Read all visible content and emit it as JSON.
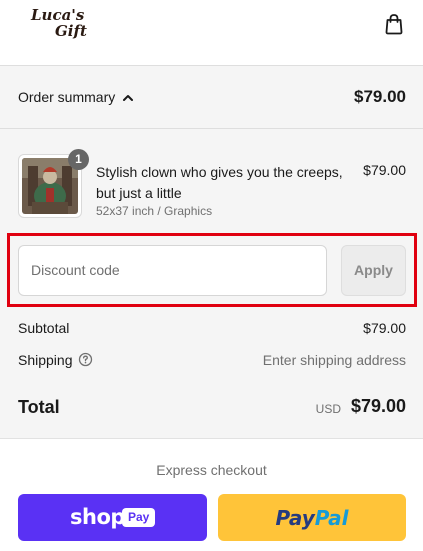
{
  "brand": {
    "logo_line1": "Luca's",
    "logo_line2": "Gift"
  },
  "header": {
    "cart_icon": "shopping-bag-icon"
  },
  "summary": {
    "toggle_label": "Order summary",
    "total": "$79.00",
    "chevron_icon": "chevron-up-icon"
  },
  "product": {
    "title": "Stylish clown who gives you the creeps, but just a little",
    "variant": "52x37 inch / Graphics",
    "price": "$79.00",
    "quantity": "1"
  },
  "discount": {
    "placeholder": "Discount code",
    "apply_label": "Apply"
  },
  "totals": {
    "subtotal_label": "Subtotal",
    "subtotal_value": "$79.00",
    "shipping_label": "Shipping",
    "shipping_value": "Enter shipping address",
    "total_label": "Total",
    "currency": "USD",
    "total_value": "$79.00"
  },
  "express": {
    "label": "Express checkout",
    "shop_pay": {
      "word": "shop",
      "pill": "Pay"
    },
    "paypal": {
      "part1": "Pay",
      "part2": "Pal"
    }
  },
  "colors": {
    "shop_pay": "#5a31f4",
    "paypal": "#ffc439",
    "highlight": "#e0000f"
  }
}
